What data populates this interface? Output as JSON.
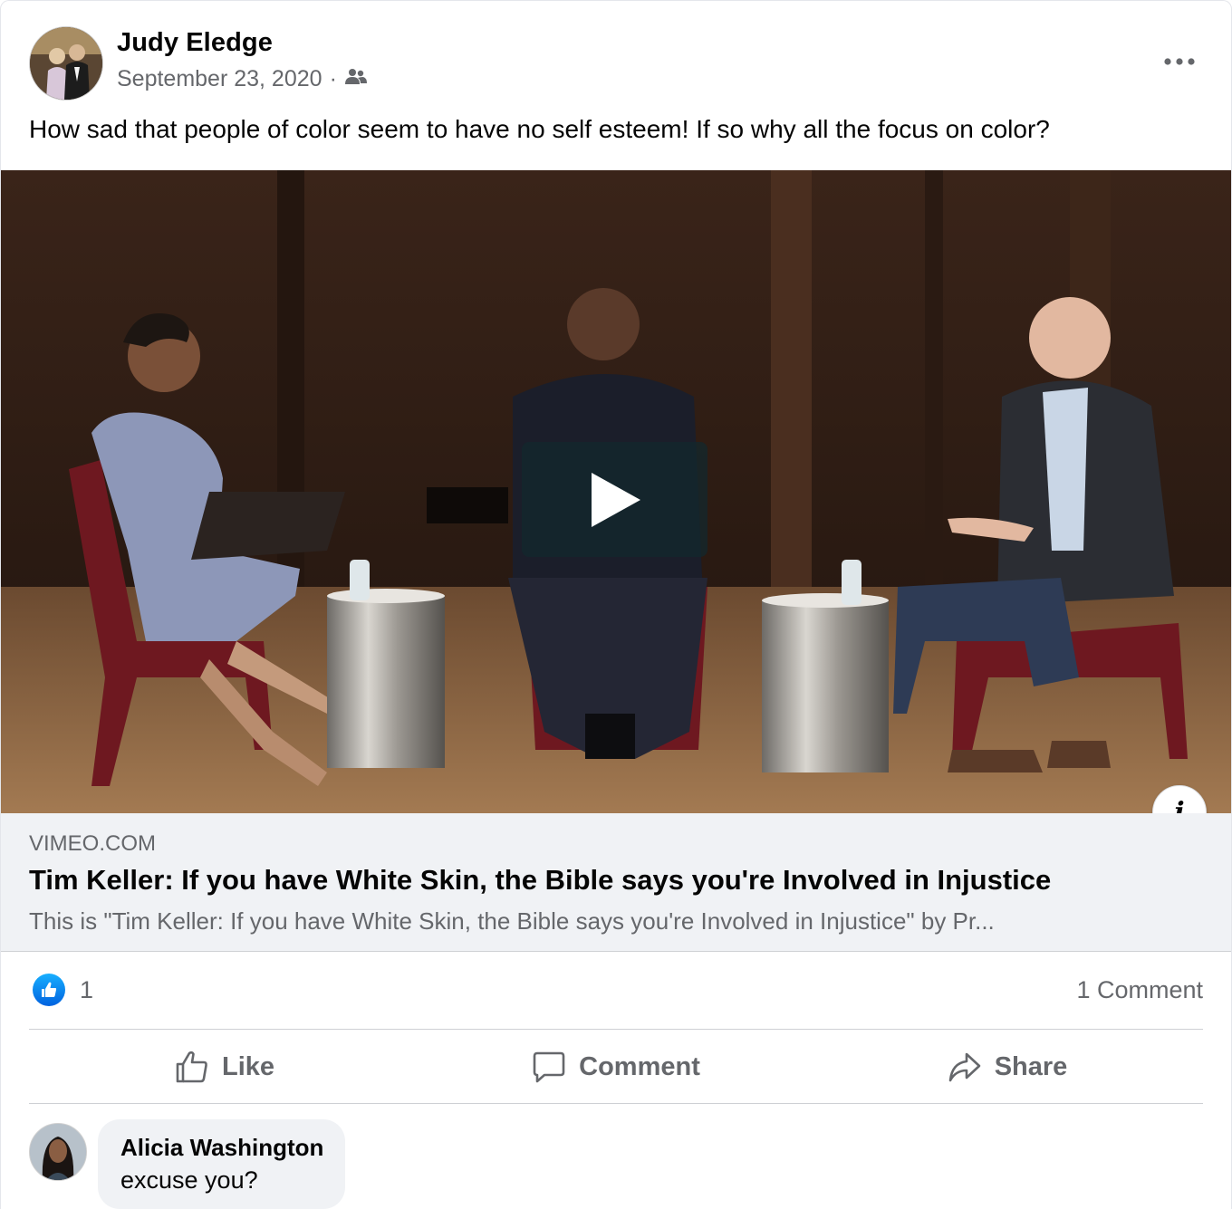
{
  "post": {
    "author": "Judy Eledge",
    "date": "September 23, 2020",
    "separator": "·",
    "audience_icon": "friends-icon",
    "text": "How sad that people of color seem to have no self esteem! If so why all the focus on color?"
  },
  "link_preview": {
    "domain": "VIMEO.COM",
    "title": "Tim Keller: If you have White Skin, the Bible says you're Involved in Injustice",
    "description": "This is \"Tim Keller: If you have White Skin, the Bible says you're Involved in Injustice\" by Pr...",
    "info_label": "i"
  },
  "stats": {
    "like_count": "1",
    "comment_count": "1 Comment"
  },
  "actions": {
    "like": "Like",
    "comment": "Comment",
    "share": "Share"
  },
  "comments": [
    {
      "author": "Alicia Washington",
      "text": "excuse you?"
    }
  ],
  "colors": {
    "accent": "#1877f2",
    "secondary_text": "#65676b",
    "link_bg": "#f0f2f5"
  }
}
